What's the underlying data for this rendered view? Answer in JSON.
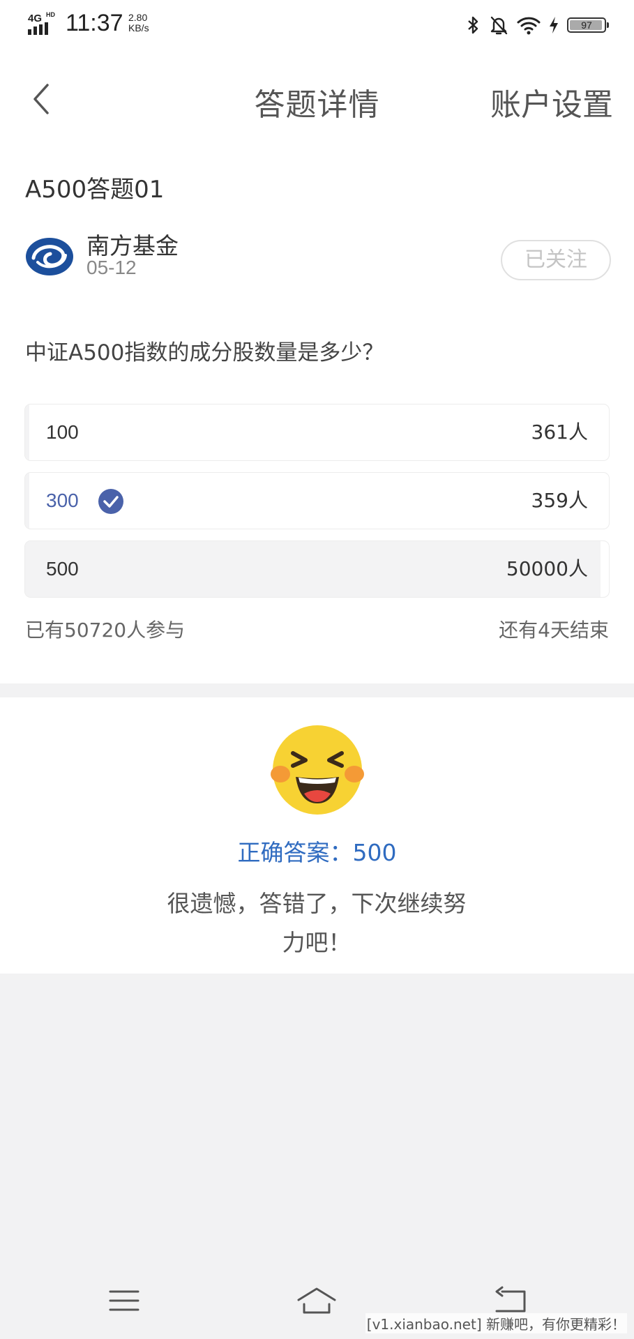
{
  "status_bar": {
    "network": "4G",
    "network_sub": "HD",
    "time": "11:37",
    "speed_value": "2.80",
    "speed_unit": "KB/s",
    "battery": "97",
    "icons": [
      "bluetooth-icon",
      "mute-bell-icon",
      "wifi-icon",
      "charging-icon",
      "battery-icon"
    ]
  },
  "nav": {
    "title": "答题详情",
    "right_label": "账户设置",
    "back_icon": "chevron-left-icon"
  },
  "quiz": {
    "title": "A500答题01",
    "author": {
      "name": "南方基金",
      "date": "05-12",
      "follow_label": "已关注"
    },
    "question": "中证A500指数的成分股数量是多少？",
    "options": [
      {
        "text": "100",
        "count": "361人",
        "share": 0.007
      },
      {
        "text": "300",
        "count": "359人",
        "share": 0.007,
        "selected": true
      },
      {
        "text": "500",
        "count": "50000人",
        "share": 0.986
      }
    ],
    "participants": "已有50720人参与",
    "remaining": "还有4天结束"
  },
  "result": {
    "emoji": "laughing-emoji-icon",
    "correct_answer": "正确答案：500",
    "message": "很遗憾，答错了，下次继续努力吧！"
  },
  "system_nav": {
    "icons": [
      "menu-icon",
      "home-icon",
      "back-icon"
    ]
  },
  "watermark": "[v1.xianbao.net] 新赚吧，有你更精彩！",
  "colors": {
    "accent_blue": "#2f6bc0",
    "selected_text": "#4a62aa",
    "check_badge": "#4a62aa",
    "page_bg": "#f2f2f3"
  }
}
